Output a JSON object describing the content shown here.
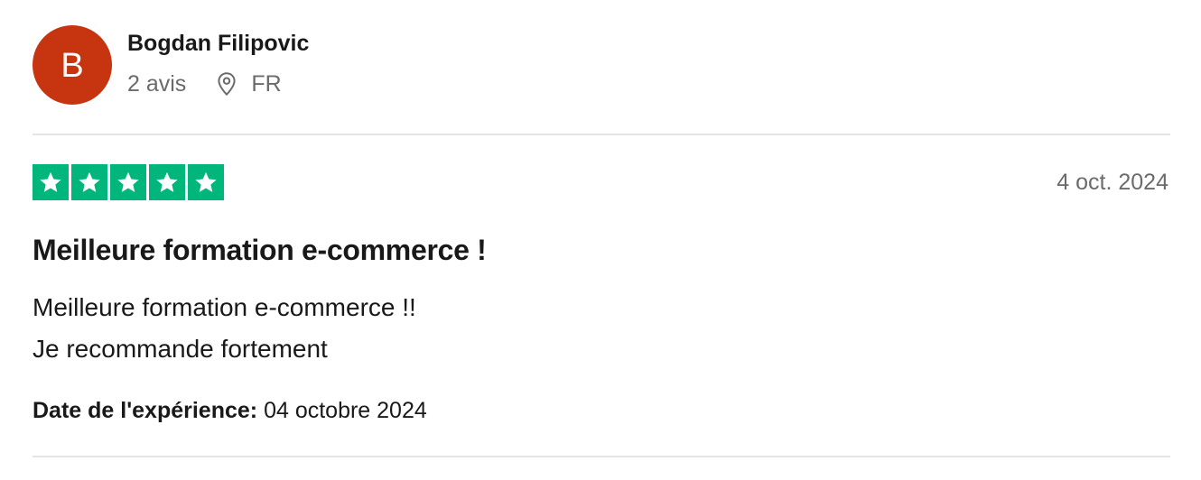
{
  "reviewer": {
    "initial": "B",
    "name": "Bogdan Filipovic",
    "review_count": "2 avis",
    "location_icon": "location-pin-icon",
    "country": "FR",
    "avatar_color": "#c6350f"
  },
  "review": {
    "rating": 5,
    "max_rating": 5,
    "star_color": "#00b67a",
    "date": "4 oct. 2024",
    "title": "Meilleure formation e-commerce !",
    "body_lines": [
      "Meilleure formation e-commerce !!",
      "Je recommande fortement"
    ],
    "experience_label": "Date de l'expérience:",
    "experience_date": "04 octobre 2024"
  }
}
